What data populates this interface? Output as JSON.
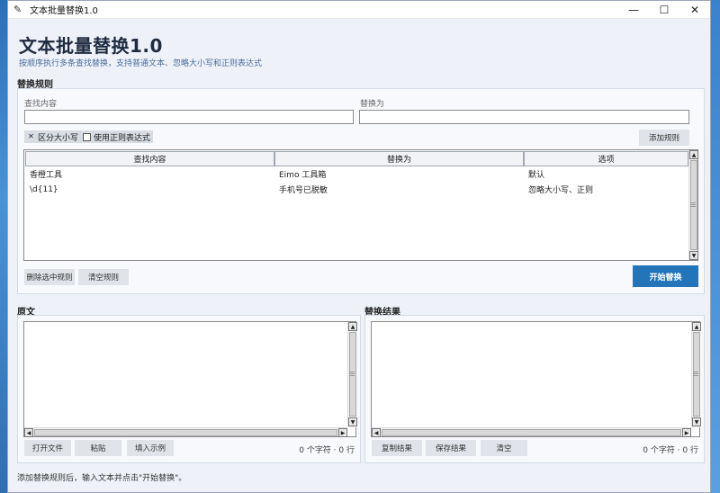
{
  "window": {
    "title": "文本批量替换1.0",
    "controls": {
      "minimize": "—",
      "maximize": "☐",
      "close": "✕"
    }
  },
  "header": {
    "title": "文本批量替换1.0",
    "subtitle": "按顺序执行多条查找替换，支持普通文本、忽略大小写和正则表达式"
  },
  "rules": {
    "section_label": "替换规则",
    "find_label": "查找内容",
    "find_value": "",
    "replace_label": "替换为",
    "replace_value": "",
    "case_sensitive_label": "区分大小写",
    "case_sensitive_checked": true,
    "case_sensitive_mark": "✕",
    "regex_label": "使用正则表达式",
    "regex_checked": false,
    "add_button": "添加规则",
    "columns": [
      "查找内容",
      "替换为",
      "选项"
    ],
    "rows": [
      {
        "find": "香橙工具",
        "replace": "Eimo 工具箱",
        "options": "默认"
      },
      {
        "find": "\\d{11}",
        "replace": "手机号已脱敏",
        "options": "忽略大小写、正则"
      }
    ],
    "delete_button": "删除选中规则",
    "clear_button": "清空规则",
    "start_button": "开始替换"
  },
  "source": {
    "section_label": "原文",
    "text": "",
    "open_button": "打开文件",
    "paste_button": "粘贴",
    "sample_button": "填入示例",
    "count": "0 个字符 · 0 行"
  },
  "result": {
    "section_label": "替换结果",
    "text": "",
    "copy_button": "复制结果",
    "save_button": "保存结果",
    "clear_button": "清空",
    "count": "0 个字符 · 0 行"
  },
  "status": "添加替换规则后，输入文本并点击\"开始替换\"。",
  "colors": {
    "accent": "#2374b8",
    "title": "#1e2b40",
    "subtitle": "#4a6a9a"
  },
  "icons": {
    "app": "feather-icon"
  }
}
